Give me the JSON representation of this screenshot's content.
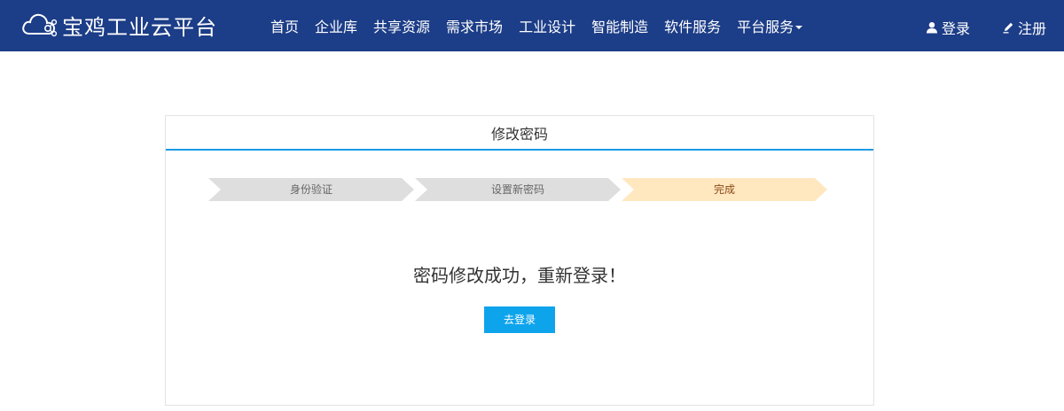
{
  "header": {
    "brand": "宝鸡工业云平台",
    "nav": [
      {
        "label": "首页"
      },
      {
        "label": "企业库"
      },
      {
        "label": "共享资源"
      },
      {
        "label": "需求市场"
      },
      {
        "label": "工业设计"
      },
      {
        "label": "智能制造"
      },
      {
        "label": "软件服务"
      },
      {
        "label": "平台服务",
        "has_dropdown": true
      }
    ],
    "login_label": "登录",
    "register_label": "注册",
    "colors": {
      "bar_background": "#1c3d87",
      "text": "#ffffff"
    }
  },
  "panel": {
    "title": "修改密码",
    "steps": [
      {
        "label": "身份验证",
        "state": "done"
      },
      {
        "label": "设置新密码",
        "state": "done"
      },
      {
        "label": "完成",
        "state": "current"
      }
    ],
    "message": "密码修改成功，重新登录！",
    "button_label": "去登录",
    "colors": {
      "header_underline": "#1a9be6",
      "step_inactive": "#dedede",
      "step_current": "#ffe7bf",
      "button": "#0ea4ec"
    }
  }
}
